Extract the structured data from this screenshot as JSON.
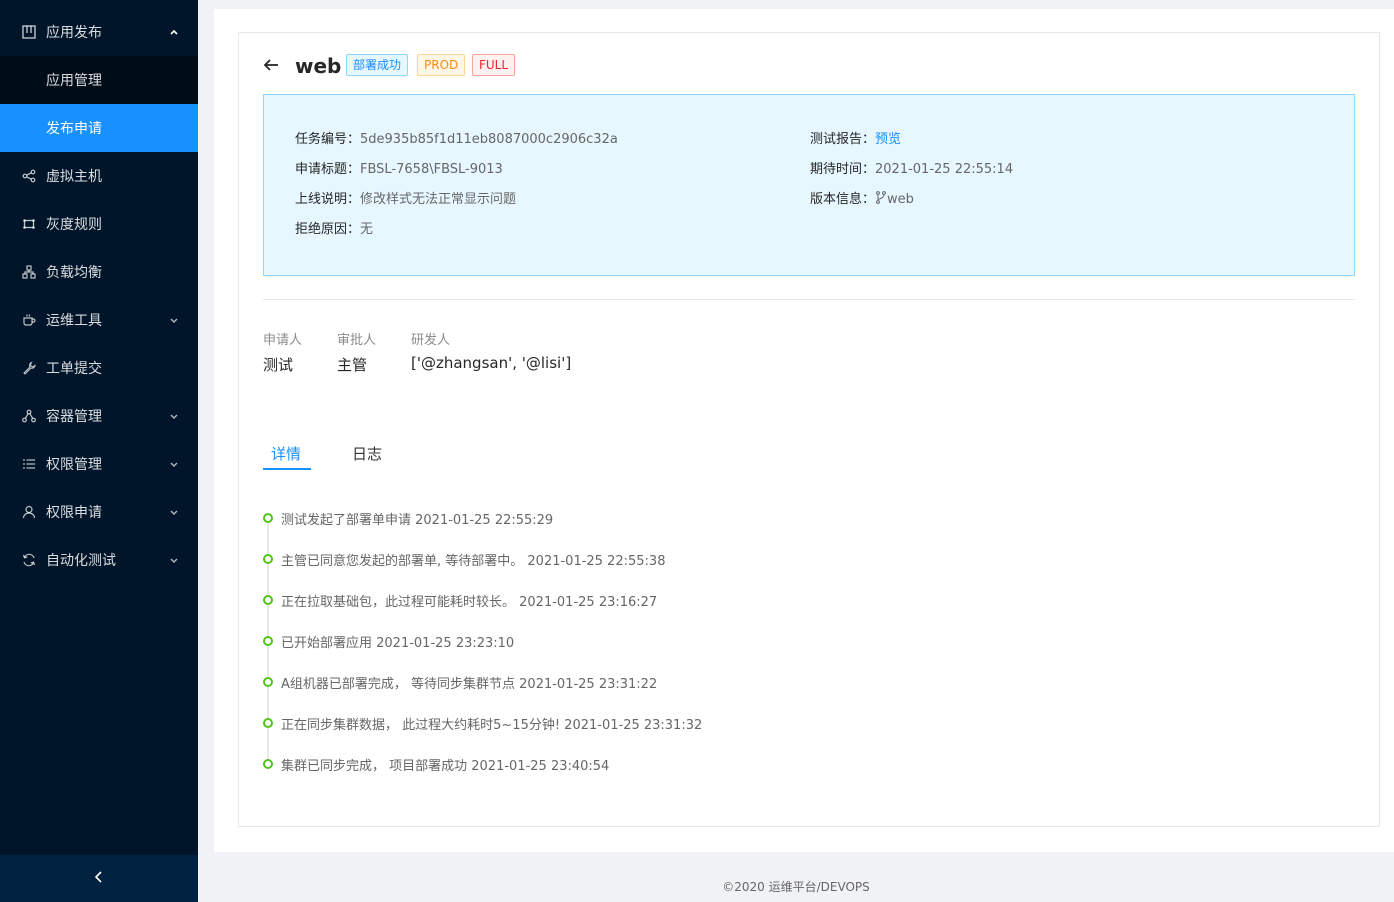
{
  "sidebar": {
    "items": [
      {
        "label": "应用发布",
        "icon": "appstore-icon",
        "arrow": "up"
      },
      {
        "label": "应用管理"
      },
      {
        "label": "发布申请"
      },
      {
        "label": "虚拟主机",
        "icon": "share-icon"
      },
      {
        "label": "灰度规则",
        "icon": "frame-icon"
      },
      {
        "label": "负载均衡",
        "icon": "cluster-icon"
      },
      {
        "label": "运维工具",
        "icon": "coffee-icon",
        "arrow": "down"
      },
      {
        "label": "工单提交",
        "icon": "wrench-icon"
      },
      {
        "label": "容器管理",
        "icon": "nodes-icon",
        "arrow": "down"
      },
      {
        "label": "权限管理",
        "icon": "list-icon",
        "arrow": "down"
      },
      {
        "label": "权限申请",
        "icon": "user-icon",
        "arrow": "down"
      },
      {
        "label": "自动化测试",
        "icon": "sync-icon",
        "arrow": "down"
      }
    ],
    "collapse_icon": "chevron-left-icon"
  },
  "header": {
    "title": "web",
    "tags": [
      "部署成功",
      "PROD",
      "FULL"
    ]
  },
  "info": {
    "task_no_label": "任务编号：",
    "task_no": "5de935b85f1d11eb8087000c2906c32a",
    "apply_title_label": "申请标题：",
    "apply_title": "FBSL-7658\\FBSL-9013",
    "online_desc_label": "上线说明：",
    "online_desc": "修改样式无法正常显示问题",
    "reject_label": "拒绝原因：",
    "reject": "无",
    "test_report_label": "测试报告：",
    "test_report_link": "预览",
    "expect_time_label": "期待时间：",
    "expect_time": "2021-01-25 22:55:14",
    "version_label": "版本信息：",
    "version": "web"
  },
  "people": {
    "applicant_label": "申请人",
    "applicant": "测试",
    "approver_label": "审批人",
    "approver": "主管",
    "developer_label": "研发人",
    "developer": "['@zhangsan', '@lisi']"
  },
  "tabs": [
    "详情",
    "日志"
  ],
  "timeline": [
    "测试发起了部署单申请 2021-01-25 22:55:29",
    "主管已同意您发起的部署单, 等待部署中。 2021-01-25 22:55:38",
    "正在拉取基础包，此过程可能耗时较长。 2021-01-25 23:16:27",
    "已开始部署应用 2021-01-25 23:23:10",
    "A组机器已部署完成， 等待同步集群节点 2021-01-25 23:31:22",
    "正在同步集群数据， 此过程大约耗时5~15分钟! 2021-01-25 23:31:32",
    "集群已同步完成， 项目部署成功 2021-01-25 23:40:54"
  ],
  "footer": "©2020 运维平台/DEVOPS",
  "colors": {
    "primary": "#1890ff",
    "sider": "#001529",
    "success": "#52c41a"
  }
}
